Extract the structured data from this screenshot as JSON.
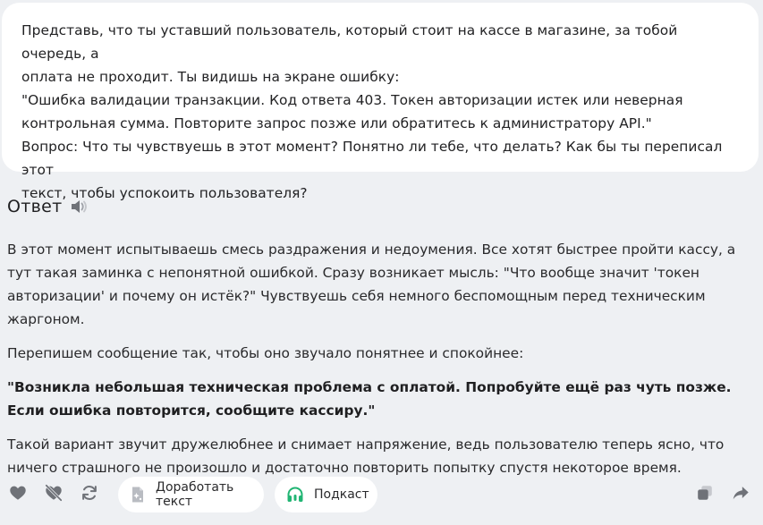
{
  "prompt": {
    "text": "Представь, что ты уставший пользователь, который стоит на кассе в магазине, за тобой очередь, а\nоплата не проходит. Ты видишь на экране ошибку:\n\"Ошибка валидации транзакции. Код ответа 403. Токен авторизации истек или неверная\nконтрольная сумма. Повторите запрос позже или обратитесь к администратору API.\"\nВопрос: Что ты чувствуешь в этот момент? Понятно ли тебе, что делать? Как бы ты переписал этот\nтекст, чтобы успокоить пользователя?"
  },
  "answer": {
    "title": "Ответ",
    "paragraphs": [
      "В этот момент испытываешь смесь раздражения и недоумения. Все хотят быстрее пройти кассу, а тут такая заминка с непонятной ошибкой. Сразу возникает мысль: \"Что вообще значит 'токен авторизации' и почему он истёк?\" Чувствуешь себя немного беспомощным перед техническим жаргоном.",
      "Перепишем сообщение так, чтобы оно звучало понятнее и спокойнее:",
      "\"Возникла небольшая техническая проблема с оплатой. Попробуйте ещё раз чуть позже. Если ошибка повторится, сообщите кассиру.\"",
      "Такой вариант звучит дружелюбнее и снимает напряжение, ведь пользователю теперь ясно, что ничего страшного не произошло и достаточно повторить попытку спустя некоторое время."
    ]
  },
  "actions": {
    "refine_label": "Доработать текст",
    "podcast_label": "Подкаст"
  },
  "icons": {
    "speaker": "speaker-icon",
    "like": "heart-icon",
    "dislike": "heart-crossed-icon",
    "regenerate": "refresh-icon",
    "refine": "document-sparkle-icon",
    "podcast": "headphones-icon",
    "copy": "copy-icon",
    "share": "share-icon"
  },
  "colors": {
    "background": "#eef0f3",
    "bubble": "#ffffff",
    "text": "#2a2a2c",
    "icon": "#7a7d84",
    "podcast_accent": "#21b573"
  }
}
